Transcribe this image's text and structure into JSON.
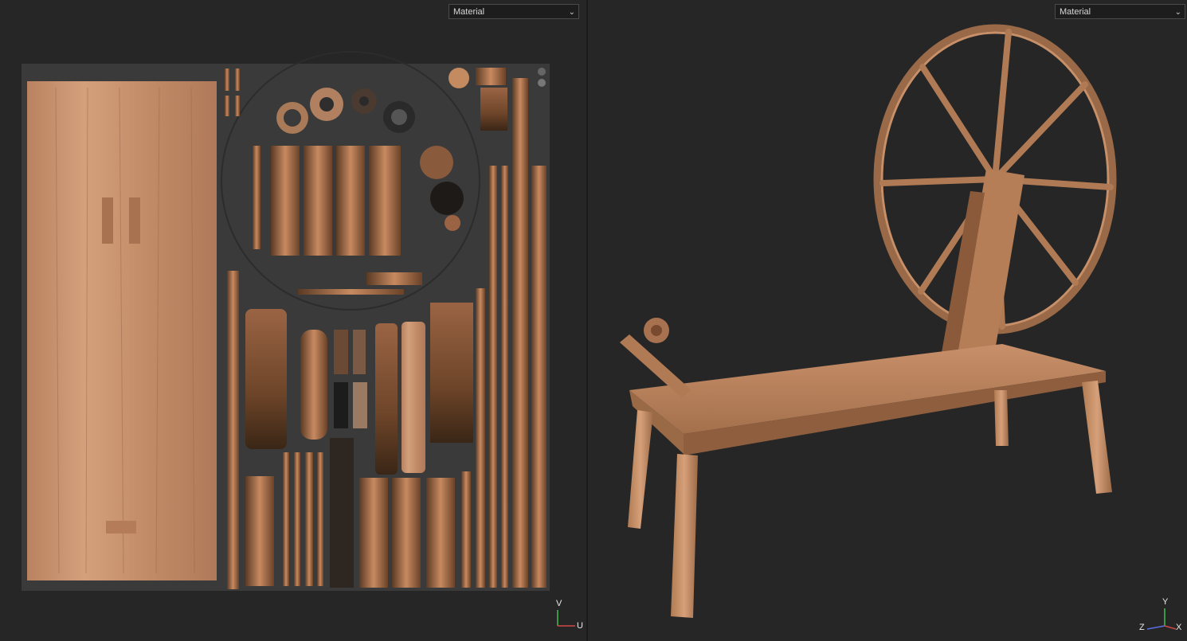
{
  "left_viewport": {
    "material_select": {
      "value": "Material",
      "icon": "chevron-down-icon"
    },
    "axis_gizmo": {
      "v_label": "V",
      "u_label": "U",
      "colors": {
        "v": "#3fbf4f",
        "u": "#d44747"
      }
    }
  },
  "right_viewport": {
    "material_select": {
      "value": "Material",
      "icon": "chevron-down-icon"
    },
    "axis_gizmo": {
      "y_label": "Y",
      "z_label": "Z",
      "x_label": "X",
      "colors": {
        "y": "#3fbf4f",
        "z": "#5a6ee0",
        "x": "#d44747"
      }
    }
  },
  "colors": {
    "background": "#262626",
    "uv_backdrop": "#3a3a3a",
    "wood_light": "#c8916a",
    "wood_mid": "#a8704a",
    "wood_dark": "#5a3a22"
  }
}
